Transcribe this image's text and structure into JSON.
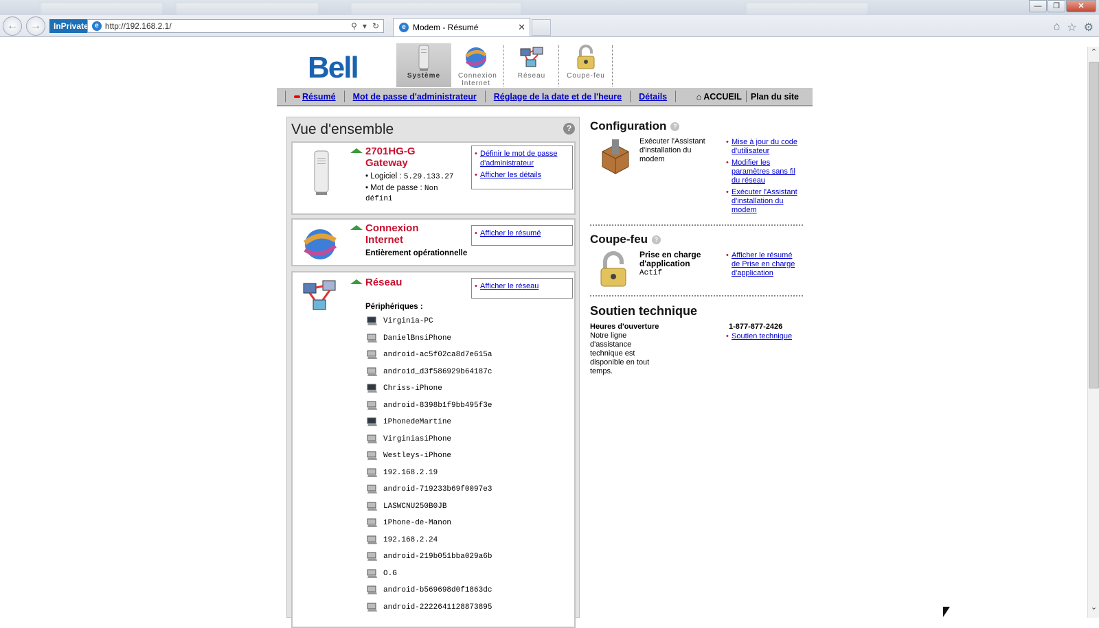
{
  "browser": {
    "inprivate": "InPrivate",
    "url": "http://192.168.2.1/",
    "tab_title": "Modem - Résumé",
    "tab_close": "✕"
  },
  "brand": {
    "logo": "Bell",
    "logo_color": "#1a63b0"
  },
  "main_nav": [
    {
      "label": "Système",
      "icon": "modem-icon",
      "active": true
    },
    {
      "label": "Connexion Internet",
      "icon": "globe-icon",
      "active": false
    },
    {
      "label": "Réseau",
      "icon": "network-computers-icon",
      "active": false
    },
    {
      "label": "Coupe-feu",
      "icon": "padlock-icon",
      "active": false
    }
  ],
  "sub_nav": {
    "items": [
      "Résumé",
      "Mot de passe d'administrateur",
      "Réglage de la date et de l'heure",
      "Détails"
    ],
    "home": "ACCUEIL",
    "sitemap": "Plan du site"
  },
  "overview": {
    "title": "Vue d'ensemble",
    "help": "?",
    "gateway": {
      "title": "2701HG-G Gateway",
      "software_label": "Logiciel :",
      "software_value": "5.29.133.27",
      "password_label": "Mot de passe :",
      "password_value": "Non défini",
      "links": [
        "Définir le mot de passe d'administrateur",
        "Afficher les détails"
      ]
    },
    "internet": {
      "title": "Connexion Internet",
      "status": "Entièrement opérationnelle",
      "links": [
        "Afficher le résumé"
      ]
    },
    "network": {
      "title": "Réseau",
      "links": [
        "Afficher le réseau"
      ],
      "devices_label": "Périphériques :",
      "devices": [
        {
          "name": "Virginia-PC",
          "active": true
        },
        {
          "name": "DanielBnsiPhone",
          "active": false
        },
        {
          "name": "android-ac5f02ca8d7e615a",
          "active": false
        },
        {
          "name": "android_d3f586929b64187c",
          "active": false
        },
        {
          "name": "Chriss-iPhone",
          "active": true
        },
        {
          "name": "android-8398b1f9bb495f3e",
          "active": false
        },
        {
          "name": "iPhonedeMartine",
          "active": true
        },
        {
          "name": "VirginiasiPhone",
          "active": false
        },
        {
          "name": "Westleys-iPhone",
          "active": false
        },
        {
          "name": "192.168.2.19",
          "active": false
        },
        {
          "name": "android-719233b69f0097e3",
          "active": false
        },
        {
          "name": "LASWCNU250B0JB",
          "active": false
        },
        {
          "name": "iPhone-de-Manon",
          "active": false
        },
        {
          "name": "192.168.2.24",
          "active": false
        },
        {
          "name": "android-219b051bba029a6b",
          "active": false
        },
        {
          "name": "O.G",
          "active": false
        },
        {
          "name": "android-b569698d0f1863dc",
          "active": false
        },
        {
          "name": "android-2222641128873895",
          "active": false
        }
      ]
    }
  },
  "configuration": {
    "title": "Configuration",
    "text": "Exécuter l'Assistant d'installation du modem",
    "links": [
      "Mise à jour du code d'utilisateur",
      "Modifier les paramètres sans fil du réseau",
      "Exécuter l'Assistant d'installation du modem"
    ]
  },
  "firewall": {
    "title": "Coupe-feu",
    "text": "Prise en charge d'application",
    "status": "Actif",
    "links": [
      "Afficher le résumé de Prise en charge d'application"
    ]
  },
  "support": {
    "title": "Soutien technique",
    "hours_label": "Heures d'ouverture",
    "hours_text": "Notre ligne d'assistance technique est disponible en tout temps.",
    "phone": "1-877-877-2426",
    "link": "Soutien technique"
  },
  "colors": {
    "accent_red": "#c8102e",
    "link": "#0000cc",
    "status_green": "#3e9a3e"
  }
}
